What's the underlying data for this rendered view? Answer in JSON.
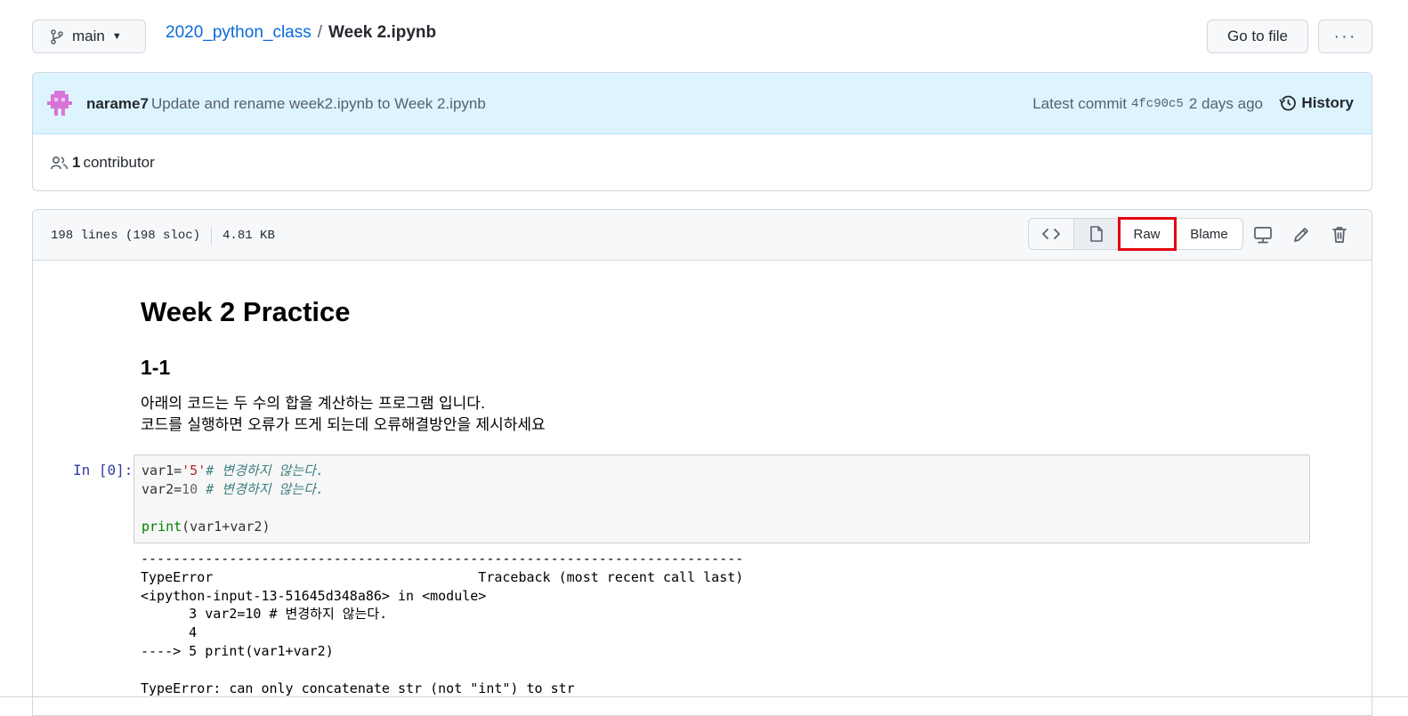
{
  "branch": {
    "name": "main"
  },
  "breadcrumb": {
    "repo": "2020_python_class",
    "separator": "/",
    "file": "Week 2.ipynb"
  },
  "actions": {
    "go_to_file": "Go to file",
    "more": "···"
  },
  "commit": {
    "author": "narame7",
    "message": "Update and rename week2.ipynb to Week 2.ipynb",
    "latest_label": "Latest commit",
    "sha": "4fc90c5",
    "time": "2 days ago",
    "history_label": "History"
  },
  "contributors": {
    "count": "1",
    "label": "contributor"
  },
  "file": {
    "lines": "198 lines (198 sloc)",
    "size": "4.81 KB",
    "raw_label": "Raw",
    "blame_label": "Blame"
  },
  "notebook": {
    "title": "Week 2 Practice",
    "section": "1-1",
    "desc_line1": "아래의 코드는 두 수의 합을 계산하는 프로그램 입니다.",
    "desc_line2": "코드를 실행하면 오류가 뜨게 되는데 오류해결방안을 제시하세요",
    "prompt": "In [0]:",
    "code": {
      "l1_var": "var1=",
      "l1_str": "'5'",
      "l1_comment": "# 변경하지 않는다.",
      "l2_var": "var2=",
      "l2_num": "10",
      "l2_comment": " # 변경하지 않는다.",
      "l4_fn": "print",
      "l4_args": "(var1+var2)"
    },
    "output": {
      "rule": "---------------------------------------------------------------------------",
      "l1": "TypeError                                 Traceback (most recent call last)",
      "l2": "<ipython-input-13-51645d348a86> in <module>",
      "l3": "      3 var2=10 # 변경하지 않는다.",
      "l4": "      4",
      "l5": "----> 5 print(var1+var2)",
      "l6": "",
      "l7": "TypeError: can only concatenate str (not \"int\") to str"
    }
  },
  "icons": [
    "branch-icon",
    "chevron-down-icon",
    "avatar",
    "history-icon",
    "people-icon",
    "code-icon",
    "file-icon",
    "desktop-icon",
    "pencil-icon",
    "trash-icon"
  ]
}
